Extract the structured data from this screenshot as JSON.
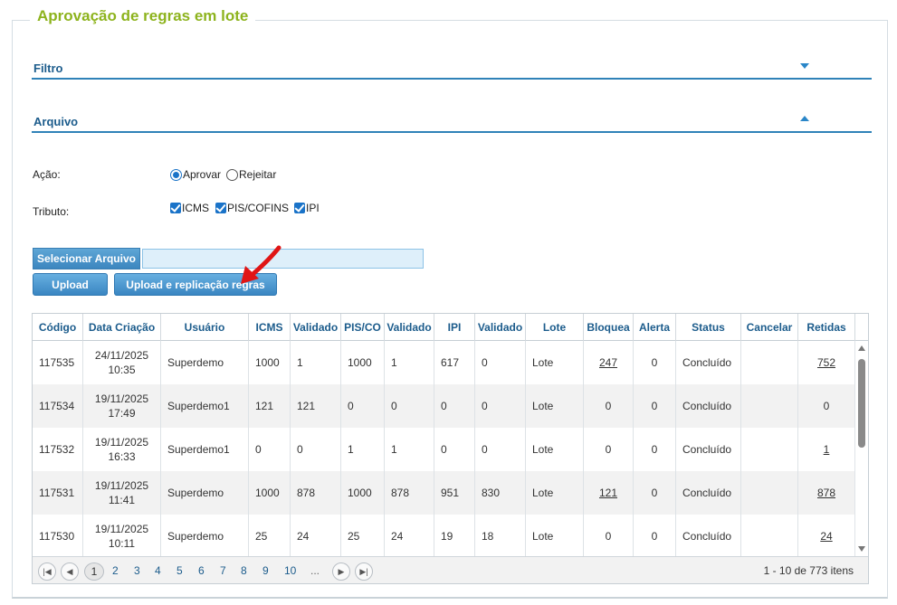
{
  "title": "Aprovação de regras em lote",
  "sections": {
    "filtro": "Filtro",
    "arquivo": "Arquivo"
  },
  "form": {
    "acao_label": "Ação:",
    "acao_options": [
      "Aprovar",
      "Rejeitar"
    ],
    "acao_selected": "Aprovar",
    "tributo_label": "Tributo:",
    "tributo_options": [
      "ICMS",
      "PIS/COFINS",
      "IPI"
    ],
    "tributo_checked": [
      "ICMS",
      "PIS/COFINS",
      "IPI"
    ]
  },
  "buttons": {
    "select_file": "Selecionar Arquivo",
    "upload": "Upload",
    "upload_replicate": "Upload e replicação regras"
  },
  "file_input_value": "",
  "grid": {
    "columns": [
      "Código",
      "Data Criação",
      "Usuário",
      "ICMS",
      "Validado",
      "PIS/CO",
      "Validado",
      "IPI",
      "Validado",
      "Lote",
      "Bloquea",
      "Alerta",
      "Status",
      "Cancelar",
      "Retidas"
    ],
    "rows": [
      {
        "codigo": "117535",
        "data": "24/11/2025",
        "hora": "10:35",
        "usuario": "Superdemo",
        "icms": "1000",
        "v1": "1",
        "pis": "1000",
        "v2": "1",
        "ipi": "617",
        "v3": "0",
        "lote": "Lote",
        "bloq": "247",
        "alerta": "0",
        "status": "Concluído",
        "retidas": "752"
      },
      {
        "codigo": "117534",
        "data": "19/11/2025",
        "hora": "17:49",
        "usuario": "Superdemo1",
        "icms": "121",
        "v1": "121",
        "pis": "0",
        "v2": "0",
        "ipi": "0",
        "v3": "0",
        "lote": "Lote",
        "bloq": "0",
        "alerta": "0",
        "status": "Concluído",
        "retidas": "0"
      },
      {
        "codigo": "117532",
        "data": "19/11/2025",
        "hora": "16:33",
        "usuario": "Superdemo1",
        "icms": "0",
        "v1": "0",
        "pis": "1",
        "v2": "1",
        "ipi": "0",
        "v3": "0",
        "lote": "Lote",
        "bloq": "0",
        "alerta": "0",
        "status": "Concluído",
        "retidas": "1"
      },
      {
        "codigo": "117531",
        "data": "19/11/2025",
        "hora": "11:41",
        "usuario": "Superdemo",
        "icms": "1000",
        "v1": "878",
        "pis": "1000",
        "v2": "878",
        "ipi": "951",
        "v3": "830",
        "lote": "Lote",
        "bloq": "121",
        "alerta": "0",
        "status": "Concluído",
        "retidas": "878"
      },
      {
        "codigo": "117530",
        "data": "19/11/2025",
        "hora": "10:11",
        "usuario": "Superdemo",
        "icms": "25",
        "v1": "24",
        "pis": "25",
        "v2": "24",
        "ipi": "19",
        "v3": "18",
        "lote": "Lote",
        "bloq": "0",
        "alerta": "0",
        "status": "Concluído",
        "retidas": "24"
      }
    ]
  },
  "pager": {
    "pages": [
      "1",
      "2",
      "3",
      "4",
      "5",
      "6",
      "7",
      "8",
      "9",
      "10",
      "..."
    ],
    "current": "1",
    "info": "1 - 10 de 773 itens"
  }
}
